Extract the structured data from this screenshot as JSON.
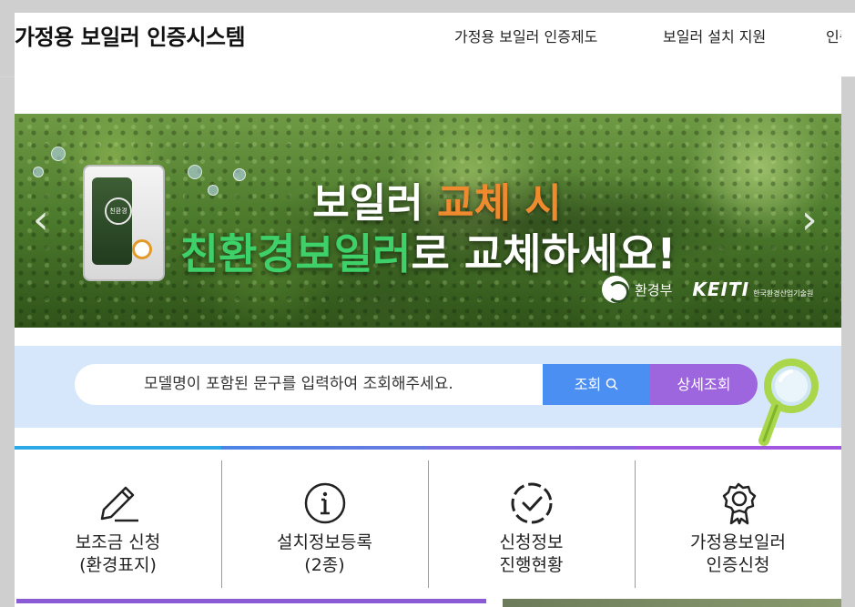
{
  "header": {
    "site_title": "가정용 보일러 인증시스템",
    "nav": [
      "가정용 보일러 인증제도",
      "보일러 설치 지원",
      "인증"
    ]
  },
  "banner": {
    "line1_a": "보일러 ",
    "line1_b": "교체 시",
    "line2_a": "친환경보일러",
    "line2_b": "로 교체하세요!",
    "boiler_logo": "친환경",
    "gov_name": "환경부",
    "keiti": "KEITI",
    "keiti_sub": "한국환경산업기술원",
    "prev": "‹",
    "next": "›"
  },
  "search": {
    "placeholder": "모델명이 포함된 문구를 입력하여 조회해주세요.",
    "search_button": "조회",
    "detail_button": "상세조회"
  },
  "quick_menu": [
    {
      "line1": "보조금 신청",
      "line2": "(환경표지)",
      "icon": "pencil-icon"
    },
    {
      "line1": "설치정보등록",
      "line2": "(2종)",
      "icon": "info-icon"
    },
    {
      "line1": "신청정보",
      "line2": "진행현황",
      "icon": "check-circle-icon"
    },
    {
      "line1": "가정용보일러",
      "line2": "인증신청",
      "icon": "award-icon"
    }
  ],
  "colors": {
    "search_button": "#4b8ff2",
    "detail_button": "#9d66de",
    "search_background": "#d7e7fb",
    "accent_orange": "#f08a2e",
    "accent_green": "#3ed16a"
  }
}
